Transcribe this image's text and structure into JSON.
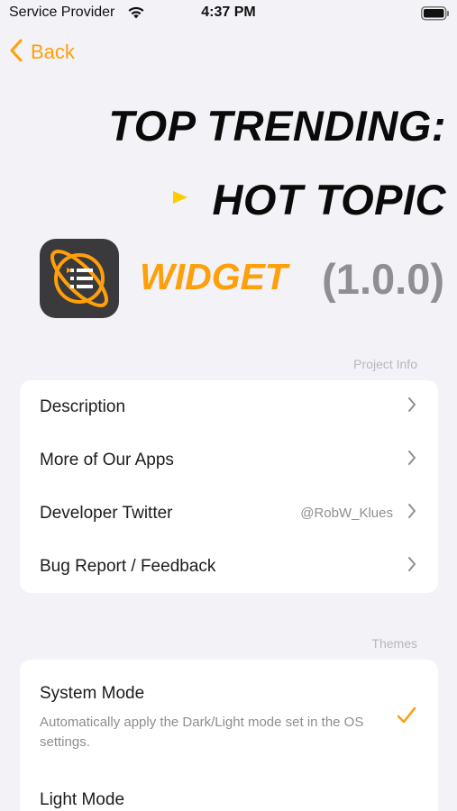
{
  "status_bar": {
    "carrier": "Service Provider",
    "time": "4:37 PM"
  },
  "nav": {
    "back_label": "Back"
  },
  "headline": {
    "line1": "TOP TRENDING:",
    "line2": "HOT TOPIC"
  },
  "app": {
    "name": "WIDGET",
    "version": "(1.0.0)",
    "icon": "orbit-list-icon"
  },
  "project_info": {
    "header": "Project Info",
    "rows": [
      {
        "label": "Description",
        "detail": ""
      },
      {
        "label": "More of Our Apps",
        "detail": ""
      },
      {
        "label": "Developer Twitter",
        "detail": "@RobW_Klues"
      },
      {
        "label": "Bug Report / Feedback",
        "detail": ""
      }
    ]
  },
  "themes": {
    "header": "Themes",
    "items": [
      {
        "title": "System Mode",
        "description": "Automatically apply the Dark/Light mode set in the OS settings.",
        "selected": true
      },
      {
        "title": "Light Mode",
        "description": "",
        "selected": false
      }
    ]
  },
  "colors": {
    "accent": "#ff9f0a",
    "play_icon": "#ffcc00",
    "background": "#f2f2f7",
    "card": "#ffffff",
    "secondary_text": "#8e8e93"
  }
}
